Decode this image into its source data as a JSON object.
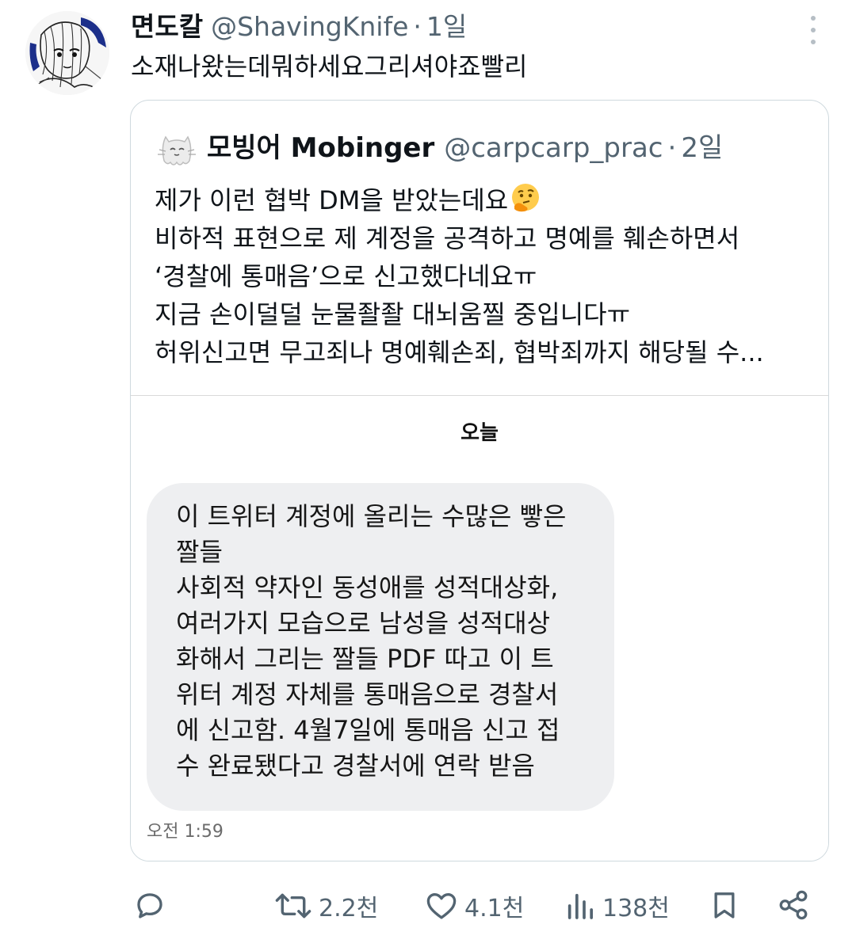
{
  "tweet": {
    "author_name": "면도칼",
    "handle": "@ShavingKnife",
    "separator": "·",
    "time": "1일",
    "text": "소재나왔는데뭐하세요그리셔야죠빨리"
  },
  "quote": {
    "author_name": "모빙어 Mobinger",
    "handle": "@carpcarp_prac",
    "separator": "·",
    "time": "2일",
    "lines": [
      "제가 이런 협박 DM을 받았는데요",
      "비하적 표현으로 제 계정을 공격하고 명예를 훼손하면서",
      "‘경찰에 통매음’으로 신고했다네요ㅠ",
      "지금 손이덜덜 눈물좔좔 대뇌움찔 중입니다ㅠ",
      "허위신고면 무고죄나 명예훼손죄, 협박죄까지 해당될 수..."
    ],
    "emoji": "thinking-face",
    "screenshot": {
      "day_label": "오늘",
      "message_lines": [
        "이 트위터 계정에 올리는 수많은 빻은",
        "짤들",
        "사회적 약자인 동성애를 성적대상화,",
        "여러가지 모습으로 남성을 성적대상",
        "화해서 그리는 짤들 PDF 따고 이 트",
        "위터 계정 자체를 통매음으로 경찰서",
        "에 신고함. 4월7일에 통매음 신고 접",
        "수 완료됐다고 경찰서에 연락 받음"
      ],
      "message_time": "오전 1:59"
    }
  },
  "actions": {
    "reply": {
      "icon": "reply-icon",
      "count": ""
    },
    "retweet": {
      "icon": "retweet-icon",
      "count": "2.2천"
    },
    "like": {
      "icon": "heart-icon",
      "count": "4.1천"
    },
    "views": {
      "icon": "views-icon",
      "count": "138천"
    },
    "bookmark": {
      "icon": "bookmark-icon"
    },
    "share": {
      "icon": "share-icon"
    }
  },
  "colors": {
    "text": "#0f1419",
    "secondary": "#536471",
    "border": "#cfd9de",
    "bubble": "#eeeff1"
  }
}
